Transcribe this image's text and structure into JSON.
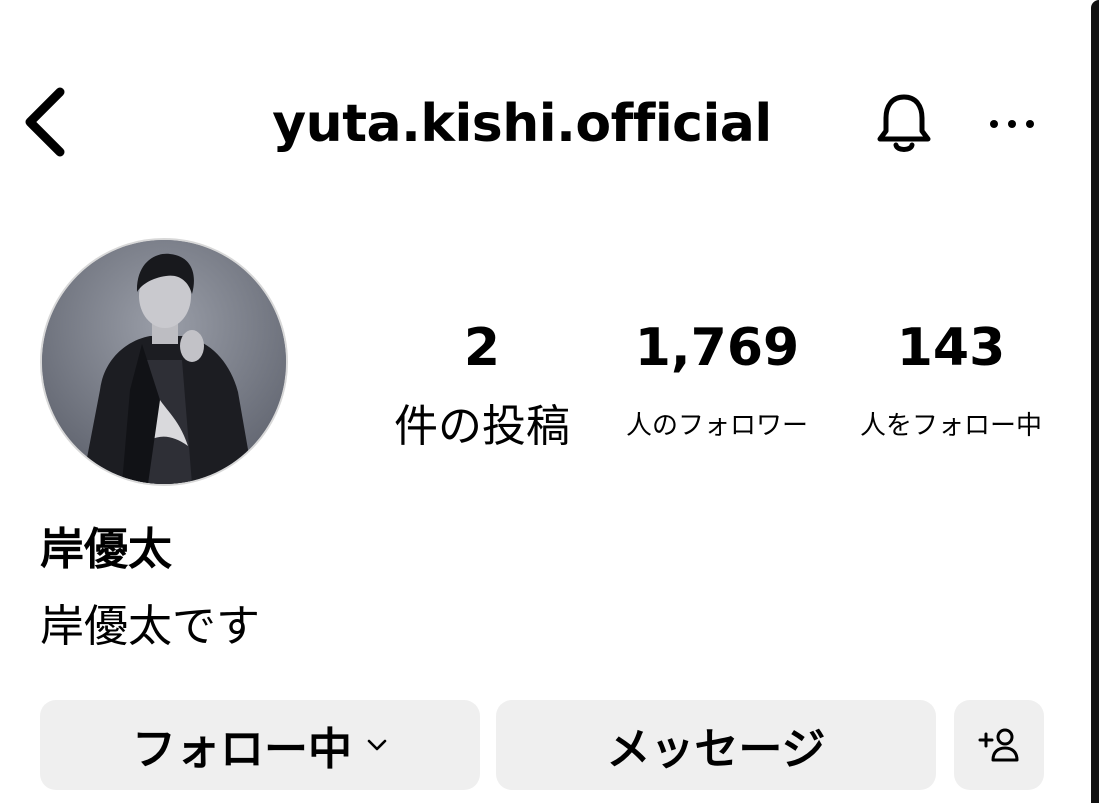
{
  "header": {
    "username": "yuta.kishi.official",
    "back_icon": "chevron-left-icon",
    "notification_icon": "bell-icon",
    "more_icon": "more-horizontal-icon"
  },
  "profile": {
    "avatar": "profile-photo",
    "stats": [
      {
        "count": "2",
        "label": "件の投稿"
      },
      {
        "count": "1,769",
        "label": "人のフォロワー"
      },
      {
        "count": "143",
        "label": "人をフォロー中"
      }
    ],
    "display_name": "岸優太",
    "bio": "岸優太です"
  },
  "actions": {
    "following_label": "フォロー中",
    "following_chevron_icon": "chevron-down-icon",
    "message_label": "メッセージ",
    "suggest_icon": "add-person-icon"
  },
  "colors": {
    "button_bg": "#efefef",
    "text": "#000000",
    "background": "#ffffff"
  }
}
